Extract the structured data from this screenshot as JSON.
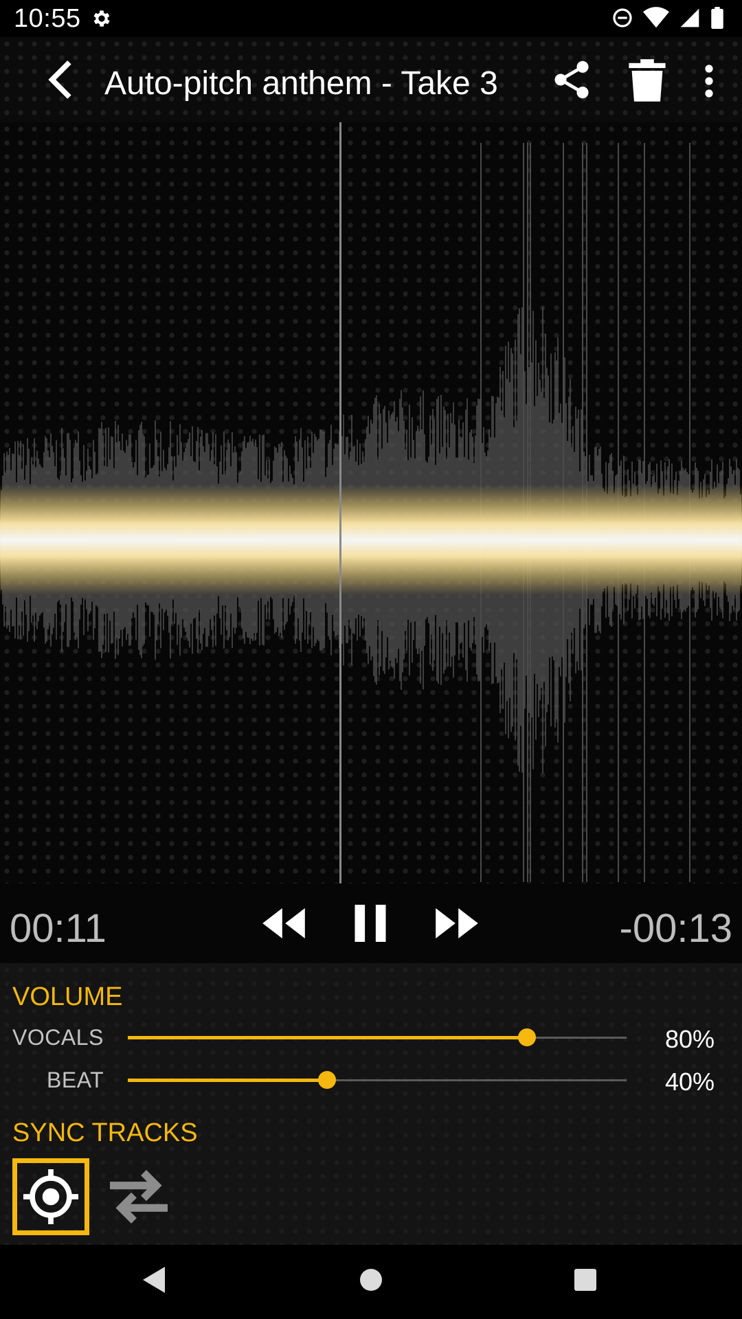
{
  "status_bar": {
    "time": "10:55",
    "icons": [
      "gear-icon",
      "do-not-disturb-icon",
      "wifi-icon",
      "cell-signal-icon",
      "battery-icon"
    ]
  },
  "toolbar": {
    "title": "Auto-pitch anthem - Take 3",
    "icons": [
      "back-arrow-icon",
      "share-icon",
      "trash-icon",
      "more-vert-icon"
    ]
  },
  "player": {
    "elapsed": "00:11",
    "remaining": "-00:13",
    "state": "playing",
    "progress": 0.458,
    "icons": [
      "rewind-icon",
      "pause-icon",
      "fast-forward-icon"
    ]
  },
  "volume": {
    "title": "VOLUME",
    "vocals": {
      "label": "VOCALS",
      "value_text": "80%",
      "value": 0.8
    },
    "beat": {
      "label": "BEAT",
      "value_text": "40%",
      "value": 0.4
    }
  },
  "sync": {
    "title": "SYNC TRACKS",
    "selected": "sync-target",
    "icons": [
      "crosshair-icon",
      "swap-arrows-icon"
    ]
  },
  "colors": {
    "accent": "#f6b80f",
    "waveform_played_core": "#fff7dc",
    "waveform_gray": "#555555",
    "background": "#070707"
  },
  "nav_bar": {
    "icons": [
      "nav-back-icon",
      "nav-home-icon",
      "nav-recents-icon"
    ]
  }
}
